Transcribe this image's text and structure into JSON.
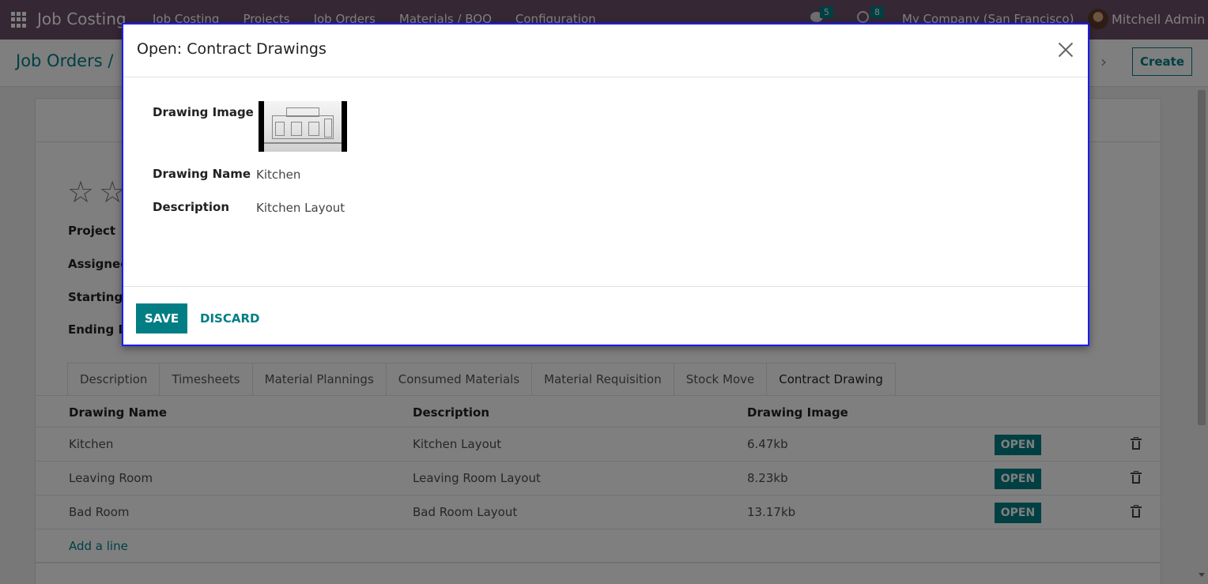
{
  "navbar": {
    "brand": "Job Costing",
    "menu": [
      "Job Costing",
      "Projects",
      "Job Orders",
      "Materials / BOQ",
      "Configuration"
    ],
    "messages_count": "5",
    "activities_count": "8",
    "company": "My Company (San Francisco)",
    "user": "Mitchell Admin"
  },
  "control": {
    "breadcrumb": "Job Orders /",
    "create_label": "Create"
  },
  "form": {
    "fields": [
      "Project",
      "Assigned",
      "Starting D",
      "Ending D"
    ],
    "tabs": [
      "Description",
      "Timesheets",
      "Material Plannings",
      "Consumed Materials",
      "Material Requisition",
      "Stock Move",
      "Contract Drawing"
    ],
    "active_tab": "Contract Drawing",
    "list": {
      "columns": [
        "Drawing Name",
        "Description",
        "Drawing Image"
      ],
      "rows": [
        {
          "name": "Kitchen",
          "description": "Kitchen Layout",
          "image": "6.47kb",
          "action": "OPEN"
        },
        {
          "name": "Leaving Room",
          "description": "Leaving Room Layout",
          "image": "8.23kb",
          "action": "OPEN"
        },
        {
          "name": "Bad Room",
          "description": "Bad Room Layout",
          "image": "13.17kb",
          "action": "OPEN"
        }
      ],
      "add_line": "Add a line"
    }
  },
  "dialog": {
    "title": "Open: Contract Drawings",
    "image_label": "Drawing Image",
    "name_label": "Drawing Name",
    "name_value": "Kitchen",
    "description_label": "Description",
    "description_value": "Kitchen Layout",
    "save_label": "SAVE",
    "discard_label": "DISCARD"
  }
}
